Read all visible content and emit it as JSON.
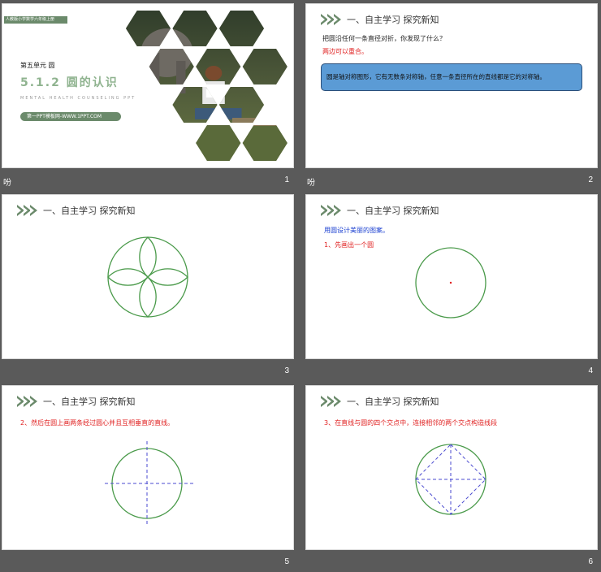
{
  "slides": [
    {
      "number": "1",
      "badge": "人教版小学数学六年级上册",
      "unit": "第五单元  圆",
      "title": "5.1.2  圆的认识",
      "subtitle": "MENTAL HEALTH COUNSELING PPT",
      "link": "第一PPT模板网-WWW.1PPT.COM",
      "corner_mark": "吩"
    },
    {
      "number": "2",
      "header": "一、自主学习  探究新知",
      "question": "把圆沿任何一条直径对折，你发现了什么？",
      "answer": "两边可以重合。",
      "callout": "圆是轴对称图形，它有无数条对称轴，任意一条直径所在的直线都是它的对称轴。",
      "corner_mark": "吩"
    },
    {
      "number": "3",
      "header": "一、自主学习  探究新知"
    },
    {
      "number": "4",
      "header": "一、自主学习  探究新知",
      "line1": "用圆设计美丽的图案。",
      "line2": "1、先画出一个圆"
    },
    {
      "number": "5",
      "header": "一、自主学习  探究新知",
      "line1": "2、然后在圆上画两条经过圆心并且互相垂直的直线。"
    },
    {
      "number": "6",
      "header": "一、自主学习  探究新知",
      "line1": "3、在直线与圆的四个交点中，连接相邻的两个交点构造线段"
    }
  ],
  "colors": {
    "accent_green": "#6b8a6b",
    "circle_green": "#4a9a4a",
    "dash_blue": "#4a4ad0",
    "red_text": "#e02020",
    "callout_blue": "#5b9bd5"
  }
}
